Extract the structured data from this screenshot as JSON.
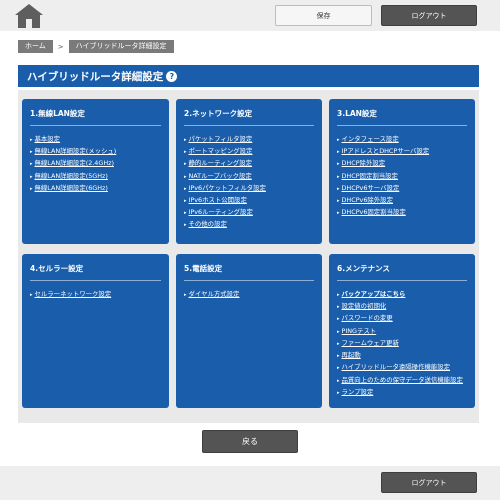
{
  "header": {
    "home_icon": "home-icon",
    "save_label": "保存",
    "logout_label": "ログアウト"
  },
  "breadcrumb": {
    "home": "ホーム",
    "separator": ">",
    "current": "ハイブリッドルータ詳細設定"
  },
  "page": {
    "title": "ハイブリッドルータ詳細設定",
    "help_icon": "question-icon"
  },
  "cards": [
    {
      "title": "1.無線LAN設定",
      "items": [
        "基本設定",
        "無線LAN詳細設定(メッシュ)",
        "無線LAN詳細設定(2.4GHz)",
        "無線LAN詳細設定(5GHz)",
        "無線LAN詳細設定(6GHz)"
      ]
    },
    {
      "title": "2.ネットワーク設定",
      "items": [
        "パケットフィルタ設定",
        "ポートマッピング設定",
        "静的ルーティング設定",
        "NATループバック設定",
        "IPv6パケットフィルタ設定",
        "IPv6ホスト公開設定",
        "IPv6ルーティング設定",
        "その他の設定"
      ]
    },
    {
      "title": "3.LAN設定",
      "items": [
        "インタフェース設定",
        "IPアドレスとDHCPサーバ設定",
        "DHCP除外設定",
        "DHCP固定割当設定",
        "DHCPv6サーバ設定",
        "DHCPv6除外設定",
        "DHCPv6固定割当設定"
      ]
    },
    {
      "title": "4.セルラー設定",
      "items": [
        "セルラーネットワーク設定"
      ]
    },
    {
      "title": "5.電話設定",
      "items": [
        "ダイヤル方式設定"
      ]
    },
    {
      "title": "6.メンテナンス",
      "items": [
        "バックアップはこちら",
        "設定値の初期化",
        "パスワードの変更",
        "PINGテスト",
        "ファームウェア更新",
        "再起動",
        "ハイブリッドルータ遠隔操作機能設定",
        "品質向上のための保守データ送信機能設定",
        "ランプ設定"
      ]
    }
  ],
  "footer": {
    "back_label": "戻る",
    "logout_label": "ログアウト"
  }
}
